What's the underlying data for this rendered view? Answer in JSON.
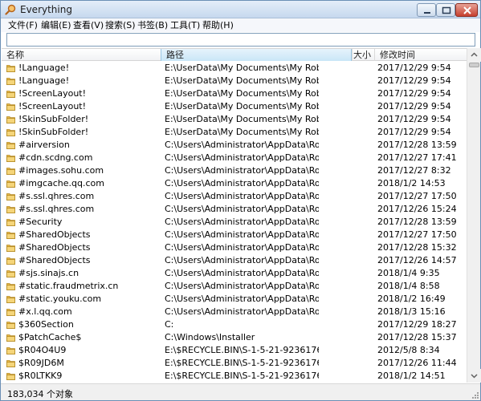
{
  "window": {
    "title": "Everything"
  },
  "menu": {
    "items": [
      "文件(F)",
      "编辑(E)",
      "查看(V)",
      "搜索(S)",
      "书签(B)",
      "工具(T)",
      "帮助(H)"
    ]
  },
  "search": {
    "value": "",
    "placeholder": ""
  },
  "columns": {
    "name": "名称",
    "path": "路径",
    "size": "大小",
    "date": "修改时间"
  },
  "rows": [
    {
      "name": "!Language!",
      "path": "E:\\UserData\\My Documents\\My RoboHel...",
      "date": "2017/12/29 9:54"
    },
    {
      "name": "!Language!",
      "path": "E:\\UserData\\My Documents\\My RoboHel...",
      "date": "2017/12/29 9:54"
    },
    {
      "name": "!ScreenLayout!",
      "path": "E:\\UserData\\My Documents\\My RoboHel...",
      "date": "2017/12/29 9:54"
    },
    {
      "name": "!ScreenLayout!",
      "path": "E:\\UserData\\My Documents\\My RoboHel...",
      "date": "2017/12/29 9:54"
    },
    {
      "name": "!SkinSubFolder!",
      "path": "E:\\UserData\\My Documents\\My RoboHel...",
      "date": "2017/12/29 9:54"
    },
    {
      "name": "!SkinSubFolder!",
      "path": "E:\\UserData\\My Documents\\My RoboHel...",
      "date": "2017/12/29 9:54"
    },
    {
      "name": "#airversion",
      "path": "C:\\Users\\Administrator\\AppData\\Roamin...",
      "date": "2017/12/28 13:59"
    },
    {
      "name": "#cdn.scdng.com",
      "path": "C:\\Users\\Administrator\\AppData\\Roamin...",
      "date": "2017/12/27 17:41"
    },
    {
      "name": "#images.sohu.com",
      "path": "C:\\Users\\Administrator\\AppData\\Roamin...",
      "date": "2017/12/27 8:32"
    },
    {
      "name": "#imgcache.qq.com",
      "path": "C:\\Users\\Administrator\\AppData\\Roamin...",
      "date": "2018/1/2 14:53"
    },
    {
      "name": "#s.ssl.qhres.com",
      "path": "C:\\Users\\Administrator\\AppData\\Roamin...",
      "date": "2017/12/27 17:50"
    },
    {
      "name": "#s.ssl.qhres.com",
      "path": "C:\\Users\\Administrator\\AppData\\Roamin...",
      "date": "2017/12/26 15:24"
    },
    {
      "name": "#Security",
      "path": "C:\\Users\\Administrator\\AppData\\Roamin...",
      "date": "2017/12/28 13:59"
    },
    {
      "name": "#SharedObjects",
      "path": "C:\\Users\\Administrator\\AppData\\Roamin...",
      "date": "2017/12/27 17:50"
    },
    {
      "name": "#SharedObjects",
      "path": "C:\\Users\\Administrator\\AppData\\Roamin...",
      "date": "2017/12/28 15:32"
    },
    {
      "name": "#SharedObjects",
      "path": "C:\\Users\\Administrator\\AppData\\Roamin...",
      "date": "2017/12/26 14:57"
    },
    {
      "name": "#sjs.sinajs.cn",
      "path": "C:\\Users\\Administrator\\AppData\\Roamin...",
      "date": "2018/1/4 9:35"
    },
    {
      "name": "#static.fraudmetrix.cn",
      "path": "C:\\Users\\Administrator\\AppData\\Roamin...",
      "date": "2018/1/4 8:58"
    },
    {
      "name": "#static.youku.com",
      "path": "C:\\Users\\Administrator\\AppData\\Roamin...",
      "date": "2018/1/2 16:49"
    },
    {
      "name": "#x.l.qq.com",
      "path": "C:\\Users\\Administrator\\AppData\\Roamin...",
      "date": "2018/1/3 15:16"
    },
    {
      "name": "$360Section",
      "path": "C:",
      "date": "2017/12/29 18:27"
    },
    {
      "name": "$PatchCache$",
      "path": "C:\\Windows\\Installer",
      "date": "2017/12/28 15:37"
    },
    {
      "name": "$R04O4U9",
      "path": "E:\\$RECYCLE.BIN\\S-1-5-21-923617662-4...",
      "date": "2012/5/8 8:34"
    },
    {
      "name": "$R09JD6M",
      "path": "E:\\$RECYCLE.BIN\\S-1-5-21-923617662-4...",
      "date": "2017/12/26 11:44"
    },
    {
      "name": "$R0LTKK9",
      "path": "E:\\$RECYCLE.BIN\\S-1-5-21-923617662-4...",
      "date": "2018/1/2 14:51"
    }
  ],
  "status": {
    "text": "183,034 个对象"
  },
  "colors": {
    "folder": "#e8b94a",
    "header_sort": "#c9e6f7",
    "border": "#7f9db9"
  },
  "icons": {
    "app": "magnifier-app-icon",
    "folder": "folder-icon"
  }
}
